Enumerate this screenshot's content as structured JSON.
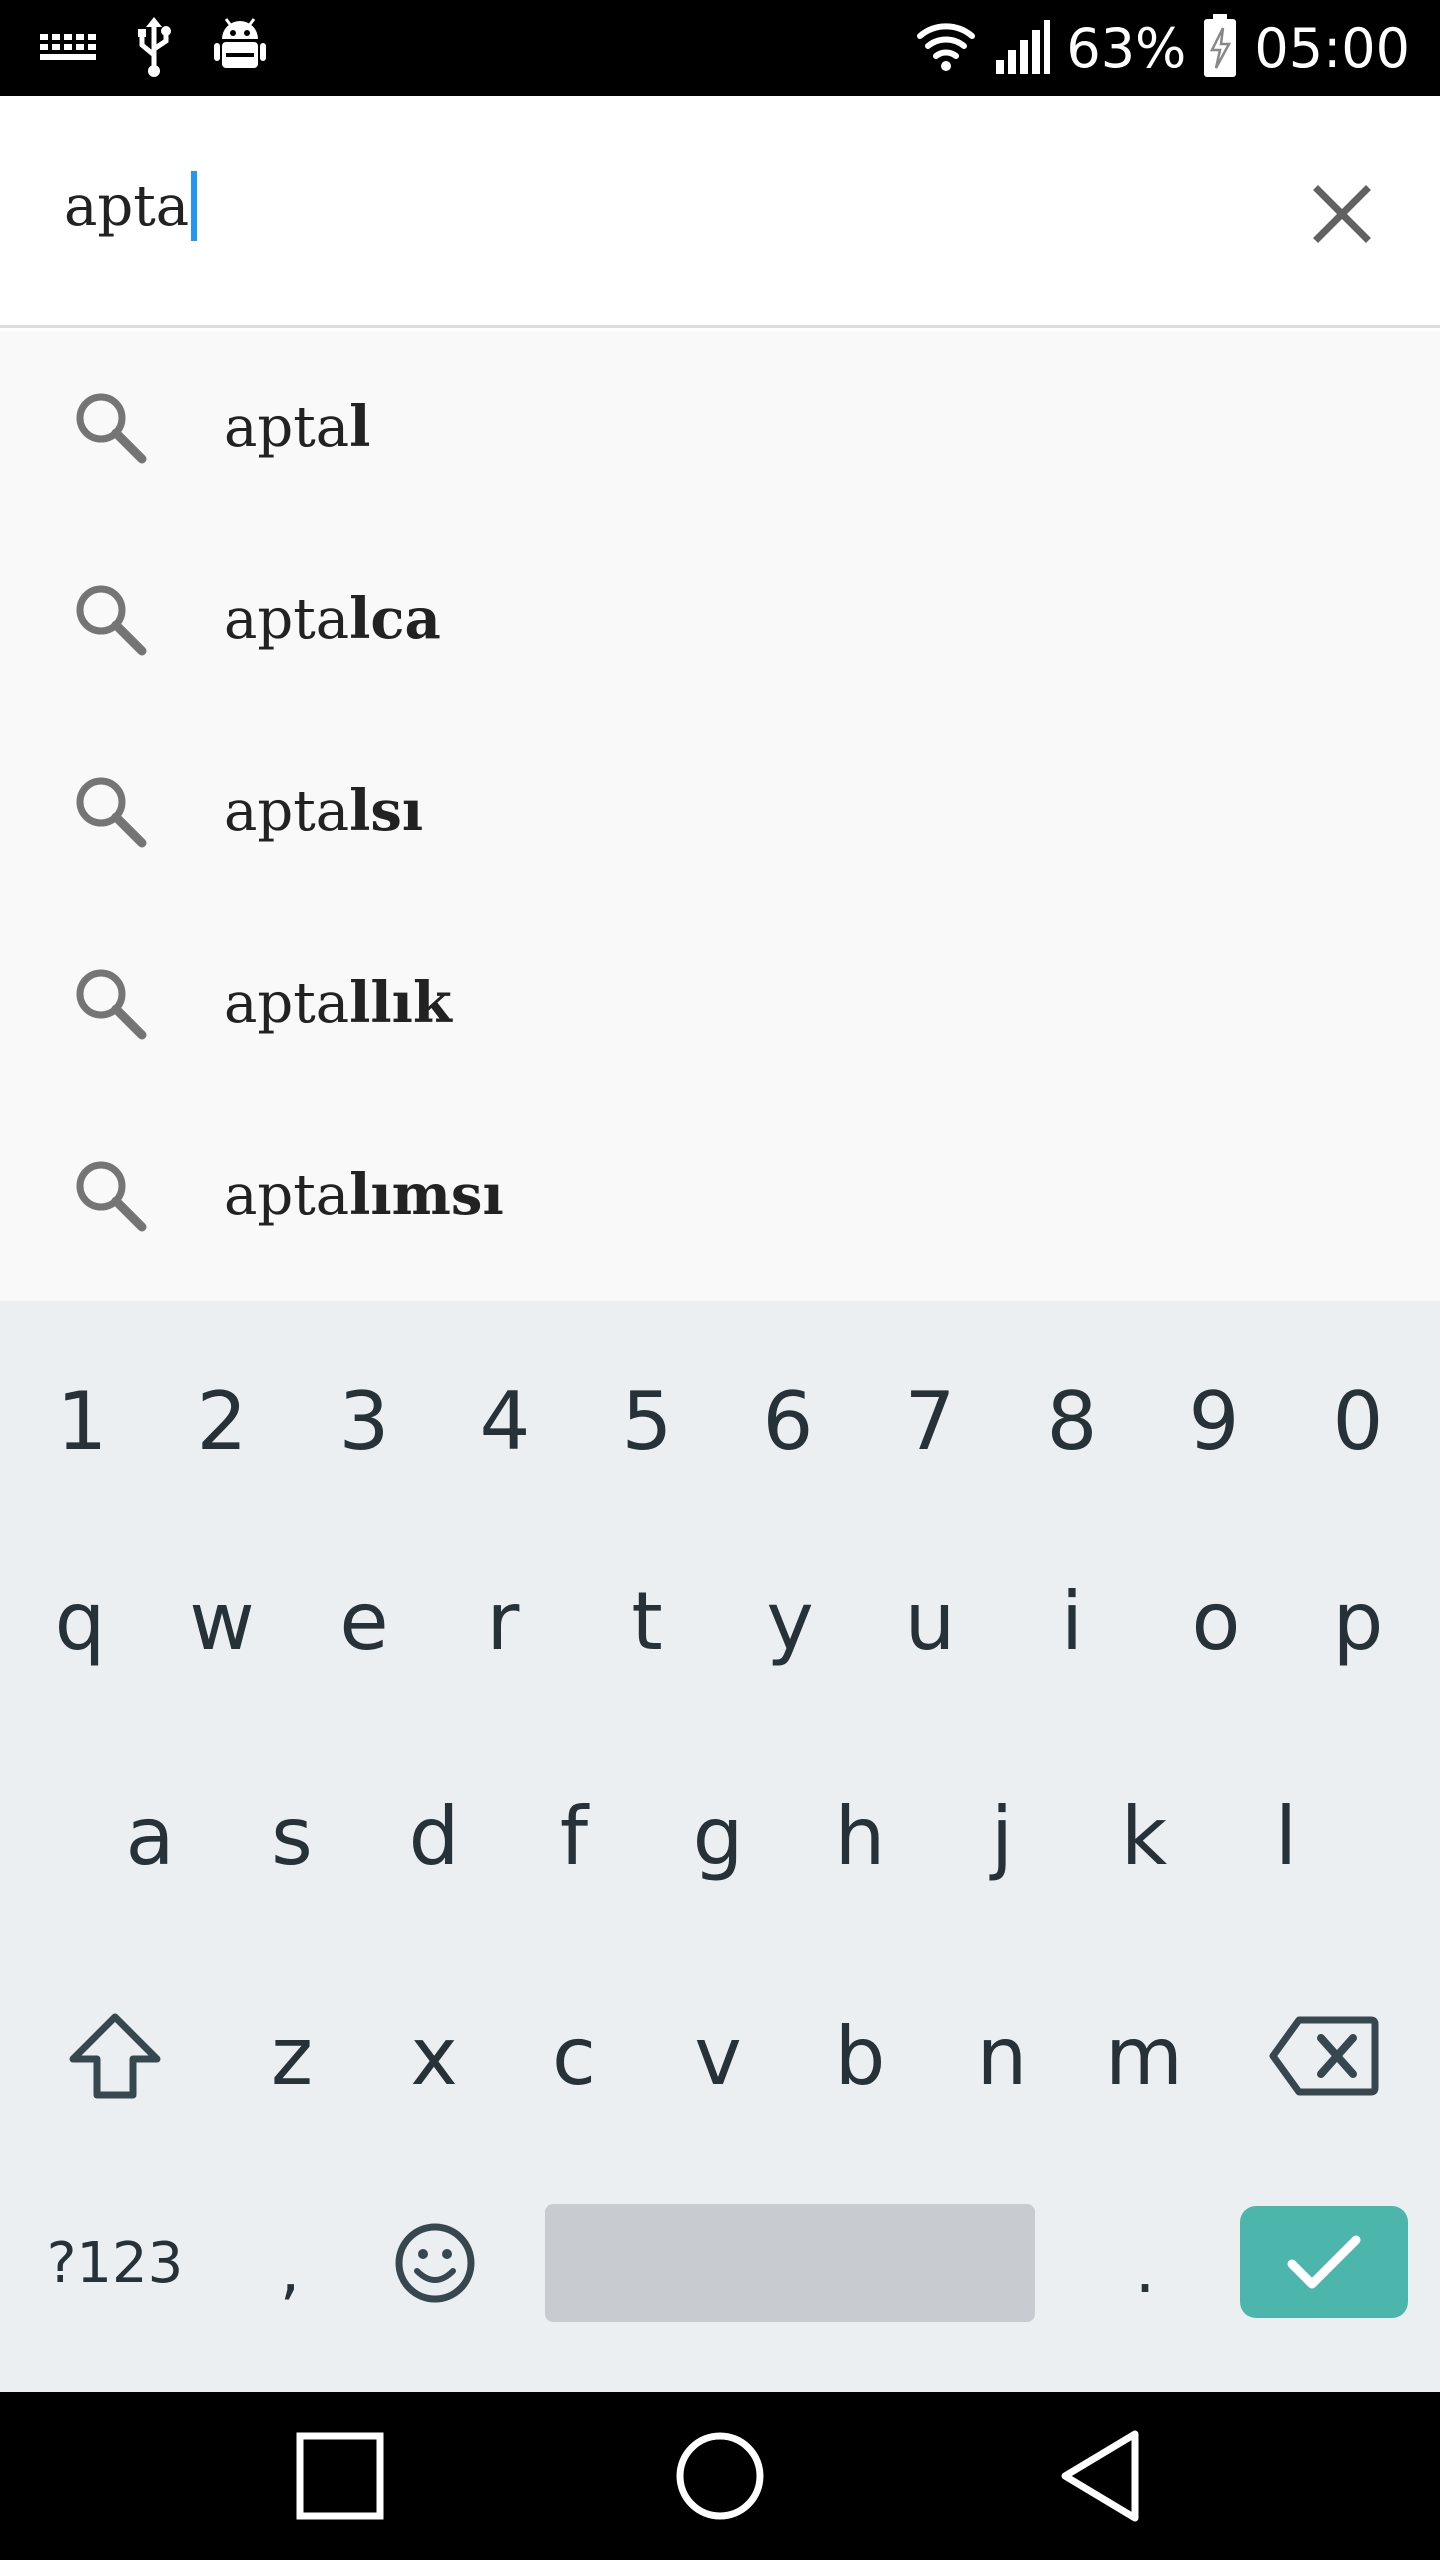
{
  "status_bar": {
    "battery": "63%",
    "time": "05:00",
    "icons": [
      "keyboard-icon",
      "usb-icon",
      "android-debug-icon",
      "wifi-icon",
      "signal-icon",
      "battery-charging-icon"
    ]
  },
  "search": {
    "query": "apta",
    "clear_icon": "close-icon"
  },
  "suggestions": [
    {
      "prefix": "apta",
      "completion": "l"
    },
    {
      "prefix": "apta",
      "completion": "lca"
    },
    {
      "prefix": "apta",
      "completion": "lsı"
    },
    {
      "prefix": "apta",
      "completion": "llık"
    },
    {
      "prefix": "apta",
      "completion": "lımsı"
    }
  ],
  "keyboard": {
    "numbers": [
      "1",
      "2",
      "3",
      "4",
      "5",
      "6",
      "7",
      "8",
      "9",
      "0"
    ],
    "row1": [
      "q",
      "w",
      "e",
      "r",
      "t",
      "y",
      "u",
      "i",
      "o",
      "p"
    ],
    "row2": [
      "a",
      "s",
      "d",
      "f",
      "g",
      "h",
      "j",
      "k",
      "l"
    ],
    "row3": [
      "z",
      "x",
      "c",
      "v",
      "b",
      "n",
      "m"
    ],
    "symbols_label": "?123",
    "comma": ",",
    "period": ".",
    "accent_color": "#4db6ac"
  },
  "nav_bar": {
    "icons": [
      "recents-square-icon",
      "home-circle-icon",
      "back-triangle-icon"
    ]
  }
}
